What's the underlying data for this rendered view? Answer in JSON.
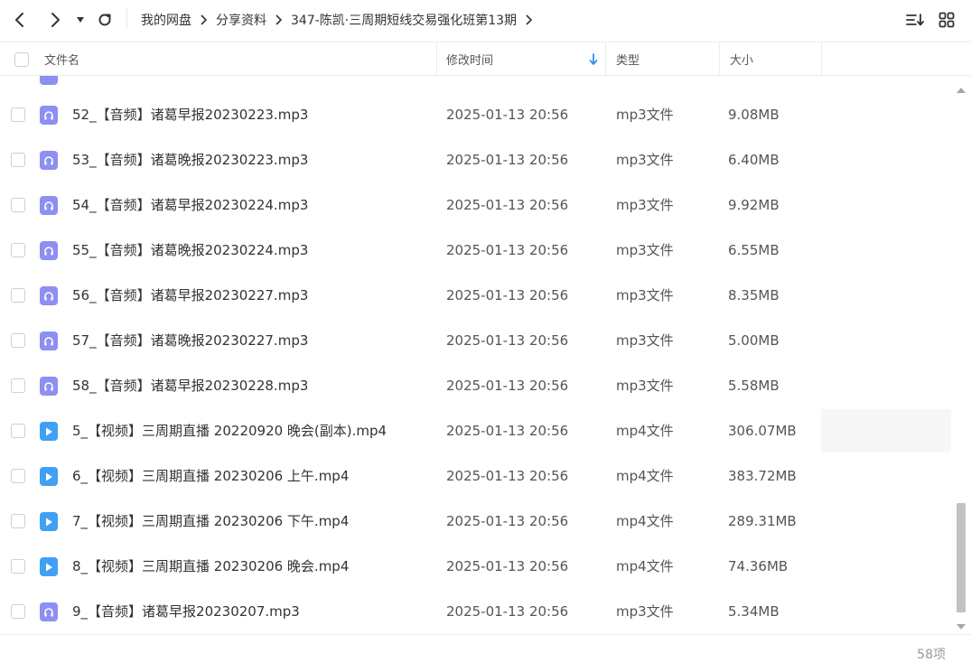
{
  "breadcrumb": [
    "我的网盘",
    "分享资料",
    "347-陈凯·三周期短线交易强化班第13期"
  ],
  "columns": {
    "name": "文件名",
    "modified": "修改时间",
    "type": "类型",
    "size": "大小"
  },
  "sort": {
    "column": "modified",
    "direction": "descending"
  },
  "rows": [
    {
      "name": "52_【音频】诸葛早报20230223.mp3",
      "date": "2025-01-13 20:56",
      "type": "mp3文件",
      "size": "9.08MB",
      "icon": "audio-file-icon"
    },
    {
      "name": "53_【音频】诸葛晚报20230223.mp3",
      "date": "2025-01-13 20:56",
      "type": "mp3文件",
      "size": "6.40MB",
      "icon": "audio-file-icon"
    },
    {
      "name": "54_【音频】诸葛早报20230224.mp3",
      "date": "2025-01-13 20:56",
      "type": "mp3文件",
      "size": "9.92MB",
      "icon": "audio-file-icon"
    },
    {
      "name": "55_【音频】诸葛晚报20230224.mp3",
      "date": "2025-01-13 20:56",
      "type": "mp3文件",
      "size": "6.55MB",
      "icon": "audio-file-icon"
    },
    {
      "name": "56_【音频】诸葛早报20230227.mp3",
      "date": "2025-01-13 20:56",
      "type": "mp3文件",
      "size": "8.35MB",
      "icon": "audio-file-icon"
    },
    {
      "name": "57_【音频】诸葛晚报20230227.mp3",
      "date": "2025-01-13 20:56",
      "type": "mp3文件",
      "size": "5.00MB",
      "icon": "audio-file-icon"
    },
    {
      "name": "58_【音频】诸葛早报20230228.mp3",
      "date": "2025-01-13 20:56",
      "type": "mp3文件",
      "size": "5.58MB",
      "icon": "audio-file-icon"
    },
    {
      "name": "5_【视频】三周期直播 20220920 晚会(副本).mp4",
      "date": "2025-01-13 20:56",
      "type": "mp4文件",
      "size": "306.07MB",
      "icon": "video-file-icon"
    },
    {
      "name": "6_【视频】三周期直播 20230206 上午.mp4",
      "date": "2025-01-13 20:56",
      "type": "mp4文件",
      "size": "383.72MB",
      "icon": "video-file-icon"
    },
    {
      "name": "7_【视频】三周期直播 20230206 下午.mp4",
      "date": "2025-01-13 20:56",
      "type": "mp4文件",
      "size": "289.31MB",
      "icon": "video-file-icon"
    },
    {
      "name": "8_【视频】三周期直播 20230206 晚会.mp4",
      "date": "2025-01-13 20:56",
      "type": "mp4文件",
      "size": "74.36MB",
      "icon": "video-file-icon"
    },
    {
      "name": "9_【音频】诸葛早报20230207.mp3",
      "date": "2025-01-13 20:56",
      "type": "mp3文件",
      "size": "5.34MB",
      "icon": "audio-file-icon"
    }
  ],
  "footer": {
    "count": "58项"
  },
  "colors": {
    "audio_icon": "#8d8ff3",
    "video_icon": "#3fa0f5",
    "sort_arrow": "#3a8ee6"
  }
}
